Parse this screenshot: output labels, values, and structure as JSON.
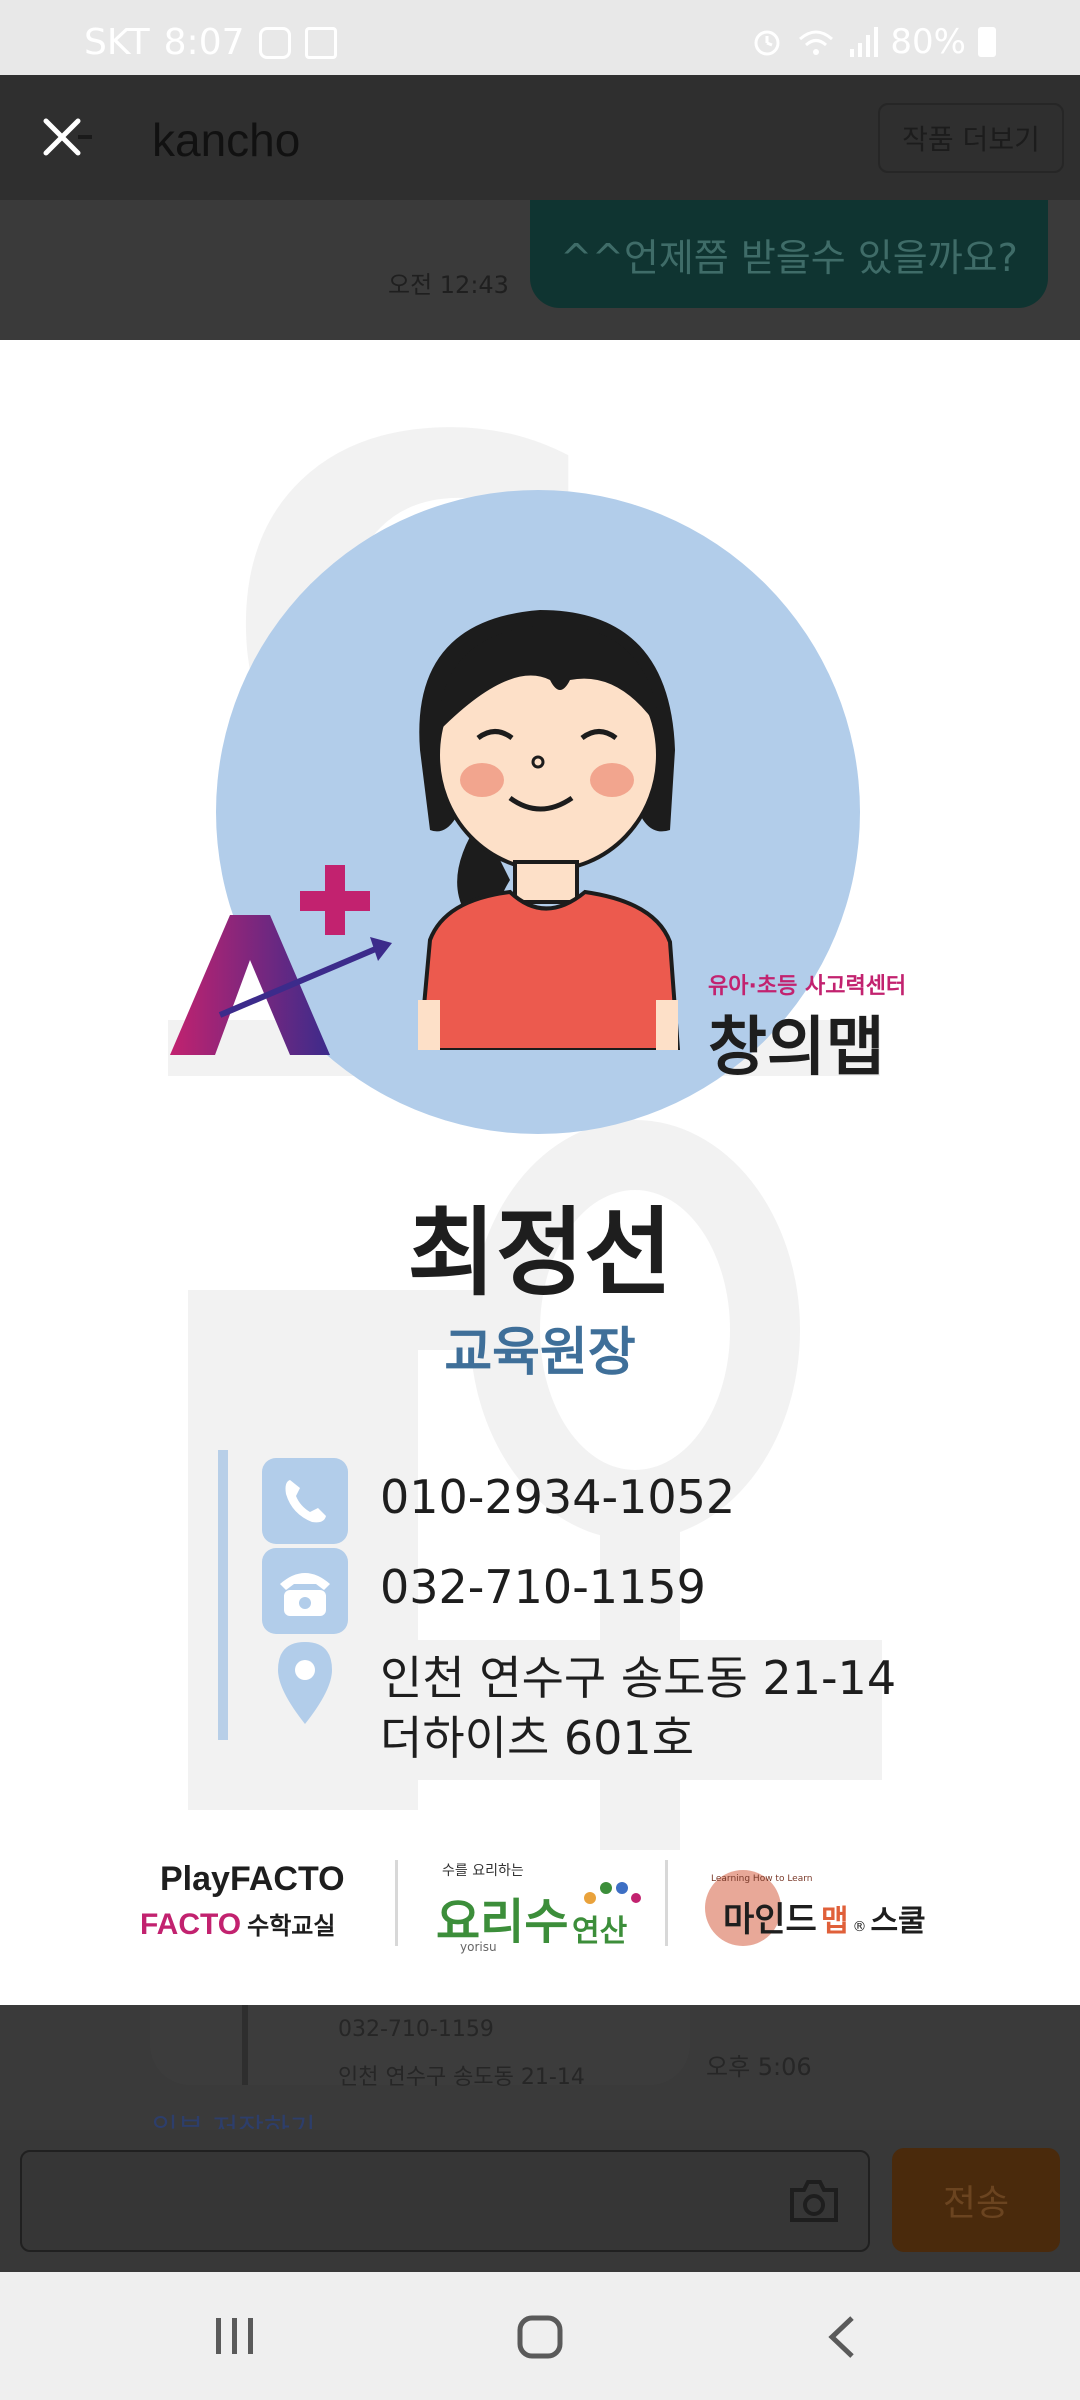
{
  "status_bar": {
    "carrier": "SKT",
    "time": "8:07",
    "battery": "80%"
  },
  "header": {
    "title": "kancho",
    "more_button": "작품 더보기"
  },
  "chat_top": {
    "message": "^^언제쯤 받을수 있을까요?",
    "time": "오전 12:43"
  },
  "card": {
    "center_label": "유아·초등 사고력센터",
    "center_name": "창의맵",
    "name": "최정선",
    "role": "교육원장",
    "mobile": "010-2934-1052",
    "phone": "032-710-1159",
    "address_line1": "인천 연수구 송도동 21-14",
    "address_line2": "더하이츠 601호",
    "brand1_top": "PlayFACTO",
    "brand1_prefix": "FACTO",
    "brand1_suffix": "수학교실",
    "brand2_tag": "수를 요리하는",
    "brand2_name": "요리수",
    "brand2_sub": "yorisu",
    "brand2_suffix": "연산",
    "brand3_tag": "Learning How to Learn",
    "brand3_name": "마인드",
    "brand3_highlight": "맵",
    "brand3_suffix": "스쿨"
  },
  "chat_bottom": {
    "preview_phone": "032-710-1159",
    "preview_address": "인천 연수구 송도동 21-14",
    "time": "오후 5:06",
    "save_link": "입부 저장하기"
  },
  "input_bar": {
    "placeholder": "",
    "send_label": "전송"
  },
  "colors": {
    "accent_blue": "#b2cdea",
    "role_blue": "#3f6f99",
    "shirt": "#ec5a4e",
    "brand_magenta": "#c2226f",
    "brand_purple": "#3c2b8b"
  }
}
